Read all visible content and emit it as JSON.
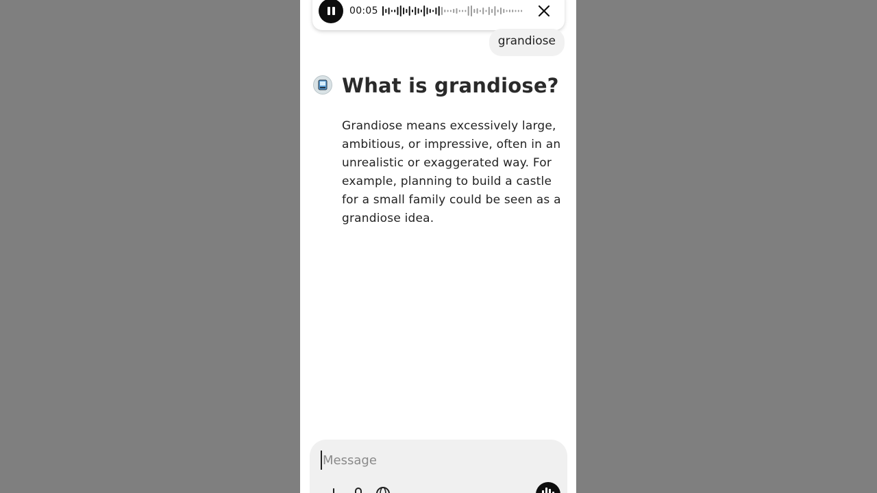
{
  "player": {
    "time": "00:05",
    "pause_icon": "pause-icon",
    "close_icon": "close-icon"
  },
  "conversation": {
    "user_message": "grandiose",
    "assistant": {
      "avatar_icon": "assistant-avatar-icon",
      "title": "What is grandiose?",
      "body": "Grandiose means excessively large, ambitious, or impressive, often in an unrealistic or exaggerated way. For example, planning to build a castle for a small family could be seen as a grandiose idea."
    }
  },
  "composer": {
    "placeholder": "Message",
    "tools": [
      "plus-icon",
      "attach-icon",
      "globe-icon"
    ],
    "voice_icon": "voice-mode-icon"
  },
  "colors": {
    "backdrop": "#7f7f7f",
    "accent_dark": "#0d0d0d",
    "bubble": "#f1f1f1"
  }
}
